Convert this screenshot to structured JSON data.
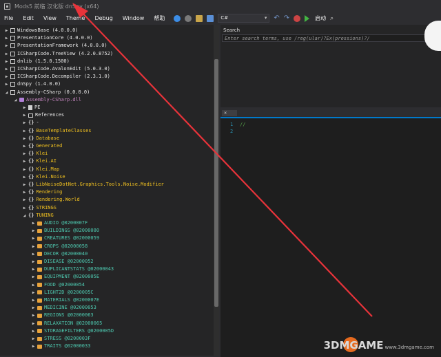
{
  "window": {
    "title": "Mods5 前临 汉化版 dnSpy (x64)"
  },
  "menu": {
    "items": [
      "File",
      "Edit",
      "View",
      "Theme",
      "Debug",
      "Window",
      "帮助"
    ]
  },
  "toolbar": {
    "language": "C#",
    "start_label": "启动"
  },
  "tree": {
    "rows": [
      {
        "indent": 0,
        "exp": "▶",
        "icon": "ref",
        "label": "WindowsBase (4.0.0.0)",
        "cls": "lbl-white"
      },
      {
        "indent": 0,
        "exp": "▶",
        "icon": "ref",
        "label": "PresentationCore (4.0.0.0)",
        "cls": "lbl-white"
      },
      {
        "indent": 0,
        "exp": "▶",
        "icon": "ref",
        "label": "PresentationFramework (4.0.0.0)",
        "cls": "lbl-white"
      },
      {
        "indent": 0,
        "exp": "▶",
        "icon": "ref",
        "label": "ICSharpCode.TreeView (4.2.0.8752)",
        "cls": "lbl-white"
      },
      {
        "indent": 0,
        "exp": "▶",
        "icon": "ref",
        "label": "dnlib (1.5.0.1500)",
        "cls": "lbl-white"
      },
      {
        "indent": 0,
        "exp": "▶",
        "icon": "ref",
        "label": "ICSharpCode.AvalonEdit (5.0.3.0)",
        "cls": "lbl-white"
      },
      {
        "indent": 0,
        "exp": "▶",
        "icon": "ref",
        "label": "ICSharpCode.Decompiler (2.3.1.0)",
        "cls": "lbl-white"
      },
      {
        "indent": 0,
        "exp": "▶",
        "icon": "ref",
        "label": "dnSpy (1.4.0.0)",
        "cls": "lbl-white"
      },
      {
        "indent": 0,
        "exp": "◢",
        "icon": "ref",
        "label": "Assembly-CSharp (0.0.0.0)",
        "cls": "lbl-white"
      },
      {
        "indent": 1,
        "exp": "◢",
        "icon": "asm",
        "label": "Assembly-CSharp.dll",
        "cls": "lbl-purple"
      },
      {
        "indent": 2,
        "exp": "▶",
        "icon": "file",
        "label": "PE",
        "cls": "lbl-white"
      },
      {
        "indent": 2,
        "exp": "▶",
        "icon": "refs",
        "label": "References",
        "cls": "lbl-white"
      },
      {
        "indent": 2,
        "exp": "▶",
        "icon": "ns",
        "label": "-",
        "cls": "lbl-white"
      },
      {
        "indent": 2,
        "exp": "▶",
        "icon": "ns",
        "label": "BaseTemplateClasses",
        "cls": "lbl-yellow"
      },
      {
        "indent": 2,
        "exp": "▶",
        "icon": "ns",
        "label": "Database",
        "cls": "lbl-yellow"
      },
      {
        "indent": 2,
        "exp": "▶",
        "icon": "ns",
        "label": "Generated",
        "cls": "lbl-yellow"
      },
      {
        "indent": 2,
        "exp": "▶",
        "icon": "ns",
        "label": "Klei",
        "cls": "lbl-yellow"
      },
      {
        "indent": 2,
        "exp": "▶",
        "icon": "ns",
        "label": "Klei.AI",
        "cls": "lbl-yellow"
      },
      {
        "indent": 2,
        "exp": "▶",
        "icon": "ns",
        "label": "Klei.Map",
        "cls": "lbl-yellow"
      },
      {
        "indent": 2,
        "exp": "▶",
        "icon": "ns",
        "label": "Klei.Noise",
        "cls": "lbl-yellow"
      },
      {
        "indent": 2,
        "exp": "▶",
        "icon": "ns",
        "label": "LibNoiseDotNet.Graphics.Tools.Noise.Modifier",
        "cls": "lbl-yellow"
      },
      {
        "indent": 2,
        "exp": "▶",
        "icon": "ns",
        "label": "Rendering",
        "cls": "lbl-yellow"
      },
      {
        "indent": 2,
        "exp": "▶",
        "icon": "ns",
        "label": "Rendering.World",
        "cls": "lbl-yellow"
      },
      {
        "indent": 2,
        "exp": "▶",
        "icon": "ns",
        "label": "STRINGS",
        "cls": "lbl-yellow"
      },
      {
        "indent": 2,
        "exp": "◢",
        "icon": "ns",
        "label": "TUNING",
        "cls": "lbl-yellow"
      },
      {
        "indent": 3,
        "exp": "▶",
        "icon": "cls",
        "label": "AUDIO @0200007F",
        "cls": "lbl-cls"
      },
      {
        "indent": 3,
        "exp": "▶",
        "icon": "cls",
        "label": "BUILDINGS @02000080",
        "cls": "lbl-cls"
      },
      {
        "indent": 3,
        "exp": "▶",
        "icon": "cls",
        "label": "CREATURES @02000059",
        "cls": "lbl-cls"
      },
      {
        "indent": 3,
        "exp": "▶",
        "icon": "cls",
        "label": "CROPS @02000058",
        "cls": "lbl-cls"
      },
      {
        "indent": 3,
        "exp": "▶",
        "icon": "cls",
        "label": "DECOR @02000040",
        "cls": "lbl-cls"
      },
      {
        "indent": 3,
        "exp": "▶",
        "icon": "cls",
        "label": "DISEASE @02000052",
        "cls": "lbl-cls"
      },
      {
        "indent": 3,
        "exp": "▶",
        "icon": "cls",
        "label": "DUPLICANTSTATS @02000043",
        "cls": "lbl-cls"
      },
      {
        "indent": 3,
        "exp": "▶",
        "icon": "cls",
        "label": "EQUIPMENT @0200005E",
        "cls": "lbl-cls"
      },
      {
        "indent": 3,
        "exp": "▶",
        "icon": "cls",
        "label": "FOOD @02000054",
        "cls": "lbl-cls"
      },
      {
        "indent": 3,
        "exp": "▶",
        "icon": "cls",
        "label": "LIGHT2D @0200005C",
        "cls": "lbl-cls"
      },
      {
        "indent": 3,
        "exp": "▶",
        "icon": "cls",
        "label": "MATERIALS @0200007E",
        "cls": "lbl-cls"
      },
      {
        "indent": 3,
        "exp": "▶",
        "icon": "cls",
        "label": "MEDICINE @02000053",
        "cls": "lbl-cls"
      },
      {
        "indent": 3,
        "exp": "▶",
        "icon": "cls",
        "label": "REGIONS @02000063",
        "cls": "lbl-cls"
      },
      {
        "indent": 3,
        "exp": "▶",
        "icon": "cls",
        "label": "RELAXATION @02000065",
        "cls": "lbl-cls"
      },
      {
        "indent": 3,
        "exp": "▶",
        "icon": "cls",
        "label": "STORAGEFILTERS @0200005D",
        "cls": "lbl-cls"
      },
      {
        "indent": 3,
        "exp": "▶",
        "icon": "cls",
        "label": "STRESS @0200003F",
        "cls": "lbl-cls"
      },
      {
        "indent": 3,
        "exp": "▶",
        "icon": "cls",
        "label": "TRAITS @02000033",
        "cls": "lbl-cls"
      }
    ]
  },
  "search": {
    "title": "Search",
    "placeholder": "Enter search terms, use /reg(ular)?Ex(pressions)?/"
  },
  "editor": {
    "tab_close": "✕",
    "line_numbers": [
      "1",
      "2"
    ],
    "lines": [
      "//",
      ""
    ]
  },
  "watermark": {
    "brand": "3DMGAME",
    "suffix": "www.3dmgame.com"
  },
  "colors": {
    "accent": "#007acc",
    "arrow": "#e8333a"
  }
}
